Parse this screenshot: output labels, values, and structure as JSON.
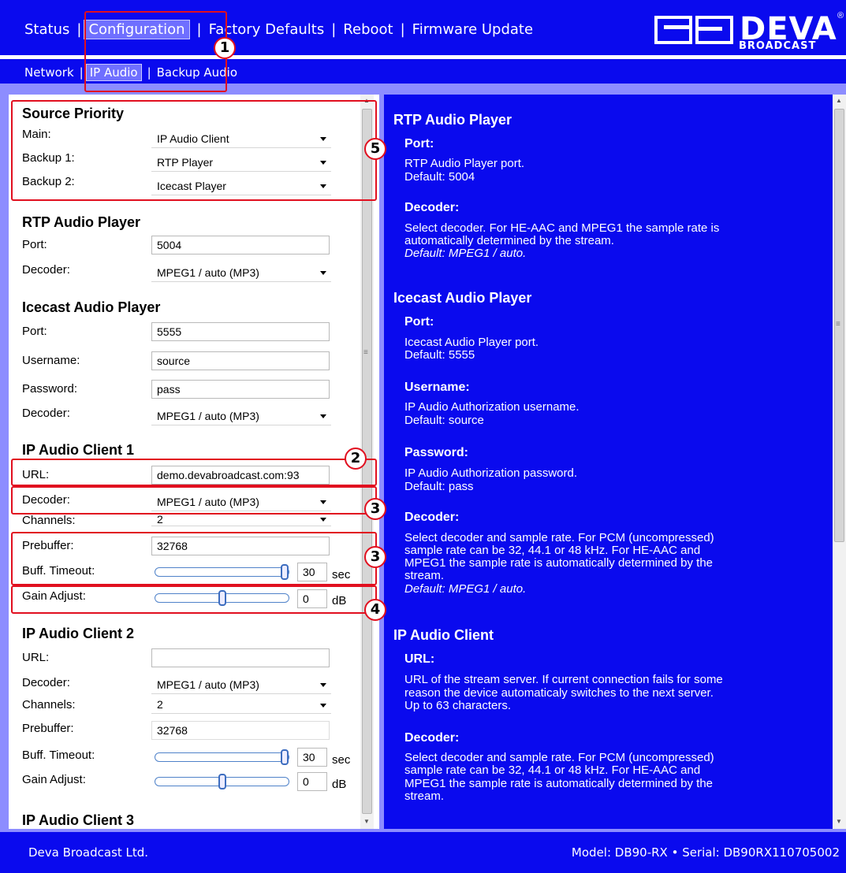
{
  "nav": {
    "status": "Status",
    "configuration": "Configuration",
    "factory_defaults": "Factory Defaults",
    "reboot": "Reboot",
    "firmware_update": "Firmware Update"
  },
  "logo": {
    "word": "DEVA",
    "sub": "BROADCAST",
    "reg": "®"
  },
  "subnav": {
    "network": "Network",
    "ip_audio": "IP Audio",
    "backup_audio": "Backup Audio"
  },
  "form": {
    "source_priority": {
      "title": "Source Priority",
      "main_label": "Main:",
      "main_value": "IP Audio Client",
      "backup1_label": "Backup 1:",
      "backup1_value": "RTP Player",
      "backup2_label": "Backup 2:",
      "backup2_value": "Icecast Player"
    },
    "rtp": {
      "title": "RTP Audio Player",
      "port_label": "Port:",
      "port_value": "5004",
      "decoder_label": "Decoder:",
      "decoder_value": "MPEG1 / auto (MP3)"
    },
    "icecast": {
      "title": "Icecast Audio Player",
      "port_label": "Port:",
      "port_value": "5555",
      "username_label": "Username:",
      "username_value": "source",
      "password_label": "Password:",
      "password_value": "pass",
      "decoder_label": "Decoder:",
      "decoder_value": "MPEG1 / auto (MP3)"
    },
    "client1": {
      "title": "IP Audio Client 1",
      "url_label": "URL:",
      "url_value": "demo.devabroadcast.com:93",
      "decoder_label": "Decoder:",
      "decoder_value": "MPEG1 / auto (MP3)",
      "channels_label": "Channels:",
      "channels_value": "2",
      "prebuffer_label": "Prebuffer:",
      "prebuffer_value": "32768",
      "timeout_label": "Buff. Timeout:",
      "timeout_value": "30",
      "timeout_unit": "sec",
      "timeout_slider_level": 1.0,
      "gain_label": "Gain Adjust:",
      "gain_value": "0",
      "gain_unit": "dB",
      "gain_slider_level": 0.5
    },
    "client2": {
      "title": "IP Audio Client 2",
      "url_label": "URL:",
      "url_value": "",
      "decoder_label": "Decoder:",
      "decoder_value": "MPEG1 / auto (MP3)",
      "channels_label": "Channels:",
      "channels_value": "2",
      "prebuffer_label": "Prebuffer:",
      "prebuffer_value": "32768",
      "timeout_label": "Buff. Timeout:",
      "timeout_value": "30",
      "timeout_unit": "sec",
      "timeout_slider_level": 1.0,
      "gain_label": "Gain Adjust:",
      "gain_value": "0",
      "gain_unit": "dB",
      "gain_slider_level": 0.5
    },
    "client3": {
      "title": "IP Audio Client 3"
    }
  },
  "help": {
    "rtp_title": "RTP Audio Player",
    "rtp_port_h": "Port:",
    "rtp_port_t1": "RTP Audio Player port.",
    "rtp_port_t2": "Default: 5004",
    "rtp_dec_h": "Decoder:",
    "rtp_dec_t1": "Select decoder. For HE-AAC and MPEG1 the sample rate is",
    "rtp_dec_t2": "automatically determined by the stream.",
    "rtp_dec_def": "Default: MPEG1 / auto.",
    "ice_title": "Icecast Audio Player",
    "ice_port_h": "Port:",
    "ice_port_t1": "Icecast Audio Player port.",
    "ice_port_t2": "Default: 5555",
    "ice_user_h": "Username:",
    "ice_user_t1": "IP Audio Authorization username.",
    "ice_user_t2": "Default: source",
    "ice_pass_h": "Password:",
    "ice_pass_t1": "IP Audio Authorization password.",
    "ice_pass_t2": "Default: pass",
    "ice_dec_h": "Decoder:",
    "ice_dec_t1": "Select decoder and sample rate. For PCM (uncompressed)",
    "ice_dec_t2": "sample rate can be 32, 44.1 or 48 kHz. For HE-AAC and",
    "ice_dec_t3": "MPEG1 the sample rate is automatically determined by the",
    "ice_dec_t4": "stream.",
    "ice_dec_def": "Default: MPEG1 / auto.",
    "cli_title": "IP Audio Client",
    "cli_url_h": "URL:",
    "cli_url_t1": "URL of the stream server. If current connection fails for some",
    "cli_url_t2": "reason the device automaticaly switches to the next server.",
    "cli_url_t3": "Up to 63 characters.",
    "cli_dec_h": "Decoder:",
    "cli_dec_t1": "Select decoder and sample rate. For PCM (uncompressed)",
    "cli_dec_t2": "sample rate can be 32, 44.1 or 48 kHz. For HE-AAC and",
    "cli_dec_t3": "MPEG1 the sample rate is automatically determined by the",
    "cli_dec_t4": "stream."
  },
  "annotations": {
    "a1": "1",
    "a2": "2",
    "a3a": "3",
    "a3b": "3",
    "a4": "4",
    "a5": "5"
  },
  "footer": {
    "company": "Deva Broadcast Ltd.",
    "model_serial": "Model: DB90-RX • Serial: DB90RX110705002"
  },
  "colors": {
    "brand_blue": "#0a0aee",
    "frame": "#8d8dff",
    "annotation_red": "#e10f1f"
  }
}
